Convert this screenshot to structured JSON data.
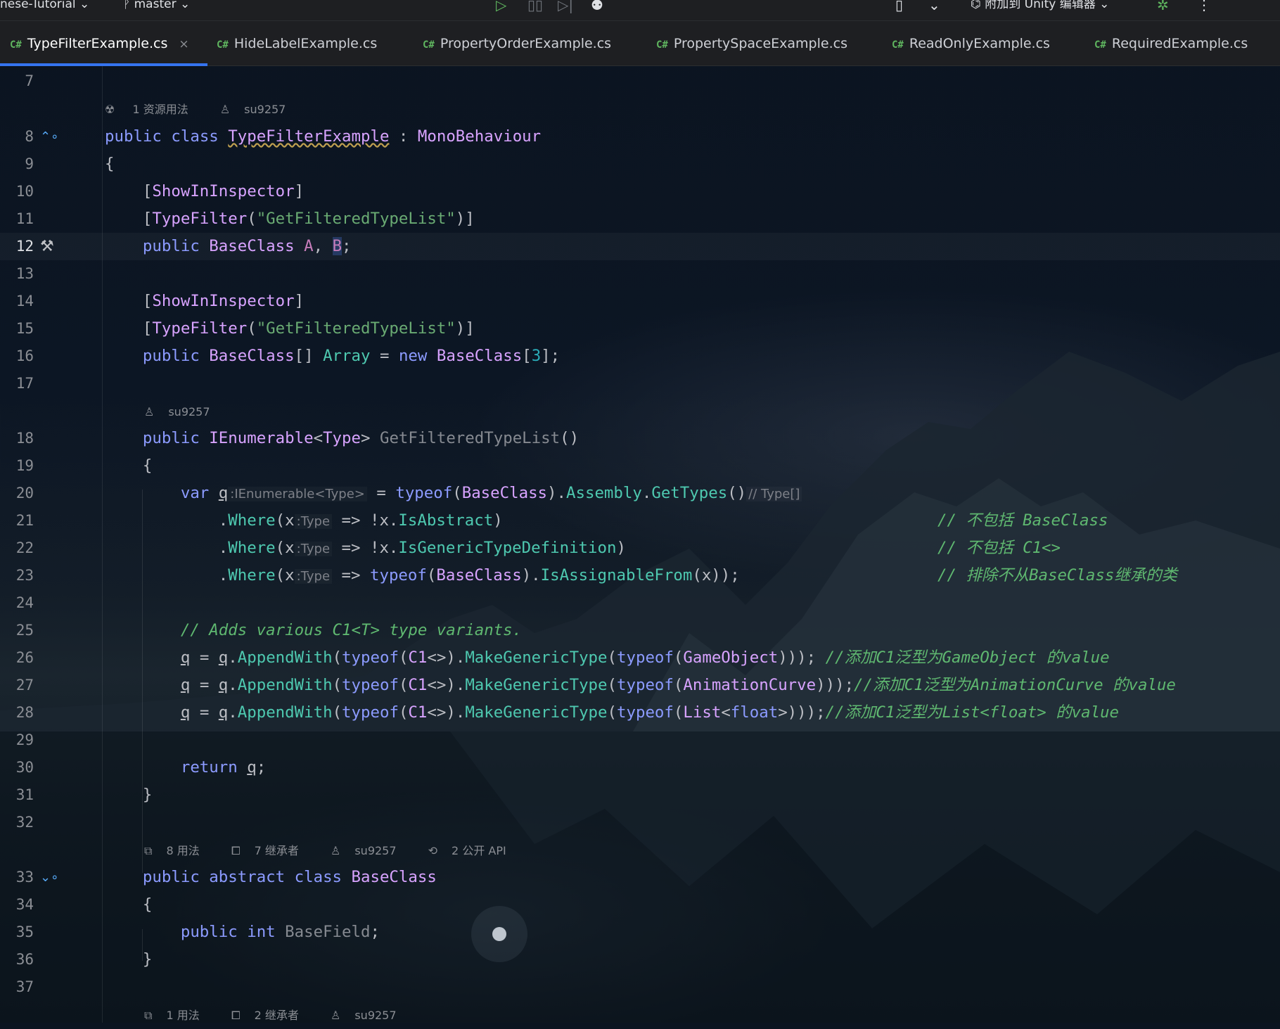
{
  "toolbar": {
    "project": "nese-Tutorial",
    "branch": "master",
    "attach": "附加到 Unity 编辑器"
  },
  "tabs": [
    {
      "label": "TypeFilterExample.cs",
      "active": true
    },
    {
      "label": "HideLabelExample.cs"
    },
    {
      "label": "PropertyOrderExample.cs"
    },
    {
      "label": "PropertySpaceExample.cs"
    },
    {
      "label": "ReadOnlyExample.cs"
    },
    {
      "label": "RequiredExample.cs"
    }
  ],
  "tab_prefix": "C#",
  "close_glyph": "×",
  "lines": [
    "7",
    "8",
    "9",
    "10",
    "11",
    "12",
    "13",
    "14",
    "15",
    "16",
    "17",
    "18",
    "19",
    "20",
    "21",
    "22",
    "23",
    "24",
    "25",
    "26",
    "27",
    "28",
    "29",
    "30",
    "31",
    "32",
    "33",
    "34",
    "35",
    "36",
    "37"
  ],
  "hints": {
    "h1_usage": "1 资源用法",
    "author": "su9257",
    "h3_usage": "8 用法",
    "h3_inherit": "7 继承者",
    "h3_api": "2 公开 API",
    "h4_usage": "1 用法",
    "h4_inherit": "2 继承者"
  },
  "code": {
    "class_name": "TypeFilterExample",
    "base_type": "MonoBehaviour",
    "attr_show": "ShowInInspector",
    "attr_filter": "TypeFilter",
    "filter_arg": "\"GetFilteredTypeList\"",
    "base_class": "BaseClass",
    "array_size": "3",
    "method_name": "GetFilteredTypeList",
    "inlay_q": ":IEnumerable<Type>",
    "inlay_types": "// Type[]",
    "inlay_x": ":Type",
    "c21": "// 不包括 BaseClass",
    "c22": "// 不包括 C1<>",
    "c23": "// 排除不从BaseClass继承的类",
    "c25": "// Adds various C1<T> type variants.",
    "c26": "//添加C1泛型为GameObject 的value",
    "c27": "//添加C1泛型为AnimationCurve 的value",
    "c28": "//添加C1泛型为List<float> 的value",
    "field_name": "BaseField"
  }
}
